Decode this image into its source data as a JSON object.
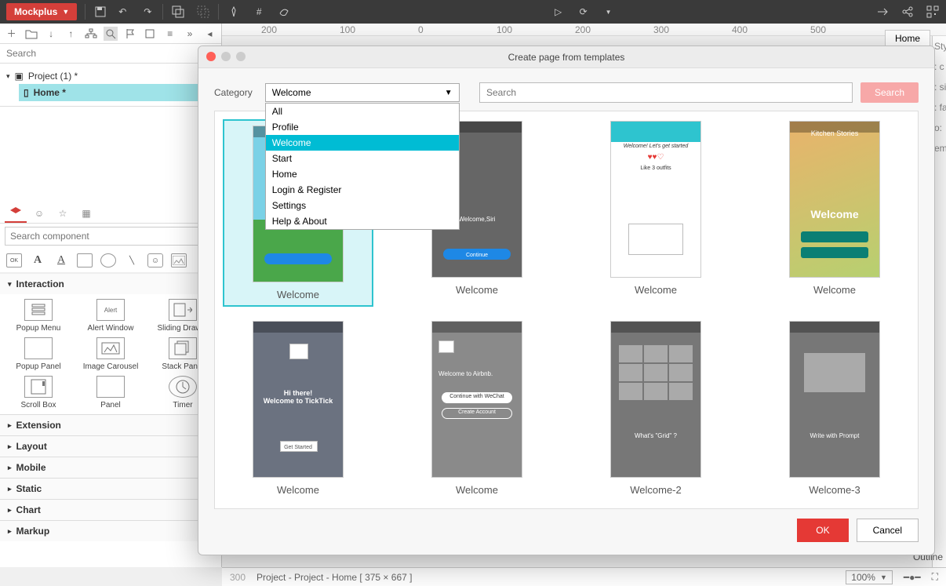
{
  "brand": "Mockplus",
  "ruler_marks": [
    "200",
    "100",
    "0",
    "100",
    "200",
    "300",
    "400",
    "500"
  ],
  "home_tab": "Home",
  "left": {
    "search_placeholder": "Search",
    "tree_root": "Project (1)  *",
    "tree_child": "Home  *",
    "comp_search_placeholder": "Search component",
    "section_interaction": "Interaction",
    "components": {
      "popup_menu": "Popup Menu",
      "alert_window": "Alert Window",
      "sliding_drawer": "Sliding Drawer",
      "popup_panel": "Popup Panel",
      "image_carousel": "Image Carousel",
      "stack_panel": "Stack Panel",
      "scroll_box": "Scroll Box",
      "panel": "Panel",
      "timer": "Timer"
    },
    "sections": {
      "extension": "Extension",
      "layout": "Layout",
      "mobile": "Mobile",
      "static": "Static",
      "chart": "Chart",
      "markup": "Markup"
    }
  },
  "right": {
    "style": "Style",
    "bg_color": ": c",
    "size": ": si",
    "face": ": fa",
    "other": "o:",
    "item": "em",
    "outline": "Outline"
  },
  "modal": {
    "title": "Create page from templates",
    "category_label": "Category",
    "category_value": "Welcome",
    "options": {
      "all": "All",
      "profile": "Profile",
      "welcome": "Welcome",
      "start": "Start",
      "home": "Home",
      "login": "Login & Register",
      "settings": "Settings",
      "help": "Help & About"
    },
    "search_placeholder": "Search",
    "search_btn": "Search",
    "templates": [
      {
        "label": "Welcome"
      },
      {
        "label": "Welcome"
      },
      {
        "label": "Welcome"
      },
      {
        "label": "Welcome"
      },
      {
        "label": "Welcome"
      },
      {
        "label": "Welcome"
      },
      {
        "label": "Welcome-2"
      },
      {
        "label": "Welcome-3"
      }
    ],
    "thumb_text": {
      "welcome_siri": "Welcome,Siri",
      "continue": "Continue",
      "welcome_lets": "Welcome! Let's get started",
      "like3": "Like 3 outfits",
      "kitchen": "Kitchen Stories",
      "welcome_big": "Welcome",
      "hi_tick": "Hi there!\nWelcome to TickTick",
      "get_started": "Get Started",
      "airbnb": "Welcome to Airbnb.",
      "wechat": "Continue with WeChat",
      "create_acc": "Create Account",
      "grid": "What's \"Grid\" ?",
      "prompt": "Write with Prompt"
    },
    "ok": "OK",
    "cancel": "Cancel"
  },
  "status": {
    "path": "Project - Project - Home [ 375 × 667 ]",
    "zoom": "100%",
    "ruler_bottom": "300"
  }
}
